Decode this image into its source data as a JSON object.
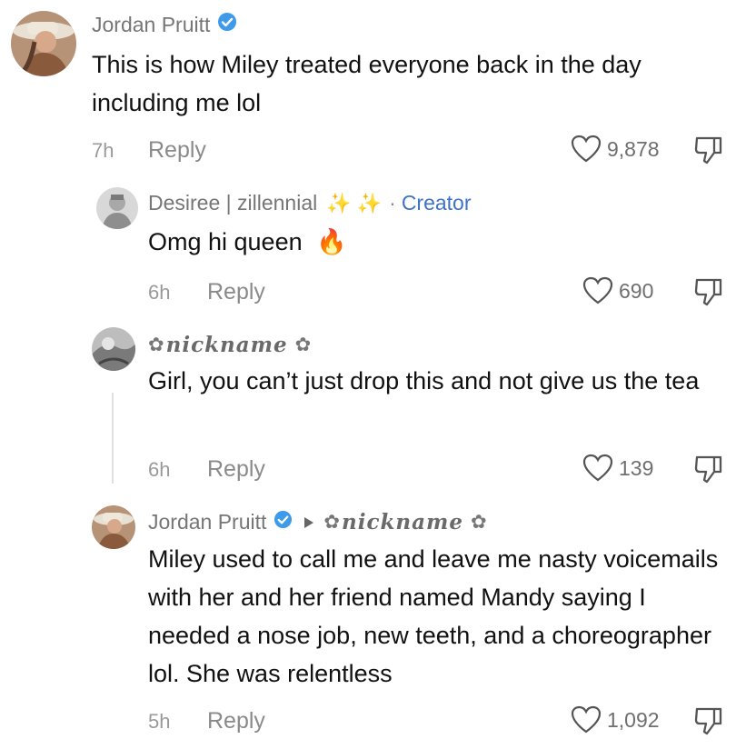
{
  "comments": [
    {
      "author": "Jordan Pruitt",
      "verified": true,
      "text": "This is how Miley treated everyone back in the day including me lol",
      "time": "7h",
      "reply_label": "Reply",
      "likes": "9,878"
    },
    {
      "author": "Desiree | zillennial",
      "sparkles": "✨ ✨",
      "separator": "·",
      "creator_label": "Creator",
      "text": "Omg hi queen",
      "emoji": "🔥",
      "time": "6h",
      "reply_label": "Reply",
      "likes": "690"
    },
    {
      "author": "nickname",
      "flower": "✿",
      "text": "Girl, you can’t just drop this and not give us the tea",
      "time": "6h",
      "reply_label": "Reply",
      "likes": "139"
    },
    {
      "author": "Jordan Pruitt",
      "verified": true,
      "reply_to": "nickname",
      "flower": "✿",
      "text": "Miley used to call me and leave me nasty voicemails with her and her friend named Mandy saying I needed a nose job, new teeth, and a choreographer lol. She was relentless",
      "time": "5h",
      "reply_label": "Reply",
      "likes": "1,092"
    }
  ],
  "colors": {
    "verified_blue": "#3d9be9",
    "creator_blue": "#3d73c8",
    "text": "#111111",
    "muted": "#767676"
  }
}
